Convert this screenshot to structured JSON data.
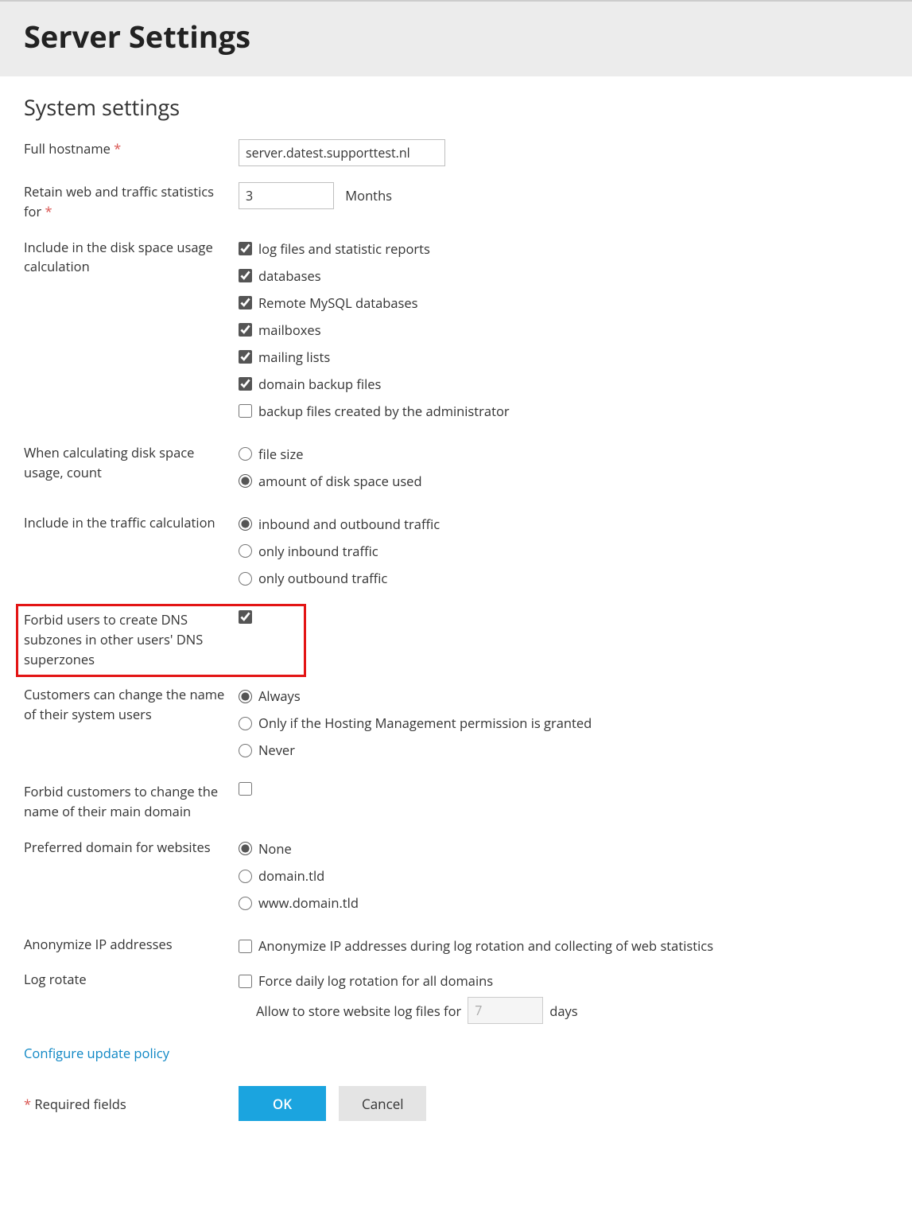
{
  "page_title": "Server Settings",
  "section_title": "System settings",
  "labels": {
    "hostname": "Full hostname",
    "retain": "Retain web and traffic statistics for",
    "months_unit": "Months",
    "diskspace": "Include in the disk space usage calculation",
    "diskcount": "When calculating disk space usage, count",
    "traffic": "Include in the traffic calculation",
    "forbid_dns": "Forbid users to create DNS subzones in other users' DNS superzones",
    "cust_rename": "Customers can change the name of their system users",
    "forbid_main": "Forbid customers to change the name of their main domain",
    "pref_domain": "Preferred domain for websites",
    "anonymize": "Anonymize IP addresses",
    "logrotate": "Log rotate",
    "log_allow": "Allow to store website log files for",
    "days_unit": "days",
    "update_link": "Configure update policy",
    "required": "Required fields",
    "ok": "OK",
    "cancel": "Cancel"
  },
  "values": {
    "hostname": "server.datest.supporttest.nl",
    "retain_months": "3",
    "log_days": "7"
  },
  "diskspace_opts": {
    "logfiles": "log files and statistic reports",
    "databases": "databases",
    "remote_mysql": "Remote MySQL databases",
    "mailboxes": "mailboxes",
    "mailing_lists": "mailing lists",
    "domain_backup": "domain backup files",
    "admin_backup": "backup files created by the administrator"
  },
  "diskcount_opts": {
    "file_size": "file size",
    "disk_used": "amount of disk space used"
  },
  "traffic_opts": {
    "both": "inbound and outbound traffic",
    "inbound": "only inbound traffic",
    "outbound": "only outbound traffic"
  },
  "rename_opts": {
    "always": "Always",
    "perm": "Only if the Hosting Management permission is granted",
    "never": "Never"
  },
  "prefdomain_opts": {
    "none": "None",
    "domain": "domain.tld",
    "www": "www.domain.tld"
  },
  "anonymize_opt": "Anonymize IP addresses during log rotation and collecting of web statistics",
  "logrotate_opt": "Force daily log rotation for all domains"
}
